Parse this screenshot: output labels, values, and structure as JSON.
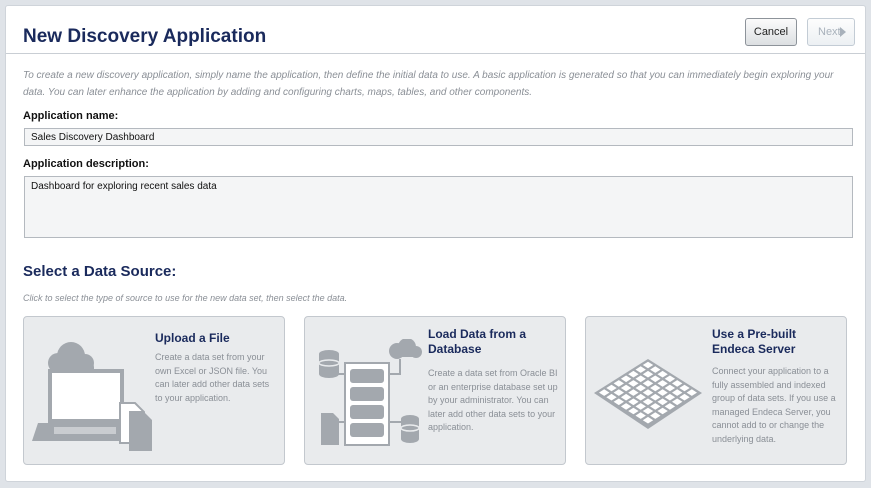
{
  "header": {
    "title": "New Discovery Application",
    "cancel_label": "Cancel",
    "next_label": "Next"
  },
  "intro_text": "To create a new discovery application, simply name the application, then define the initial data to use. A basic application is generated so that you can immediately begin exploring your data. You can later enhance the application by adding and configuring charts, maps, tables, and other components.",
  "form": {
    "name_label": "Application name:",
    "name_value": "Sales Discovery Dashboard",
    "description_label": "Application description:",
    "description_value": "Dashboard for exploring recent sales data"
  },
  "data_source": {
    "title": "Select a Data Source:",
    "hint": "Click to select the type of source to use for the new data set, then select the data.",
    "cards": [
      {
        "title": "Upload a File",
        "description": "Create a data set from your own Excel or JSON file. You can later add other data sets to your application.",
        "icon": "laptop-upload-icon"
      },
      {
        "title": "Load Data from a Database",
        "description": "Create a data set from Oracle BI or an enterprise database set up by your administrator. You can later add other data sets to your application.",
        "icon": "database-icon"
      },
      {
        "title": "Use a Pre-built Endeca Server",
        "description": "Connect your application to a fully assembled and indexed group of data sets. If you use a managed Endeca Server, you cannot add to or change the underlying data.",
        "icon": "endeca-server-grid-icon"
      }
    ]
  },
  "colors": {
    "title": "#1a2a5c",
    "card_background": "#e9ebed",
    "muted_text": "#8a8f96",
    "art_gray": "#a3a8ae"
  }
}
